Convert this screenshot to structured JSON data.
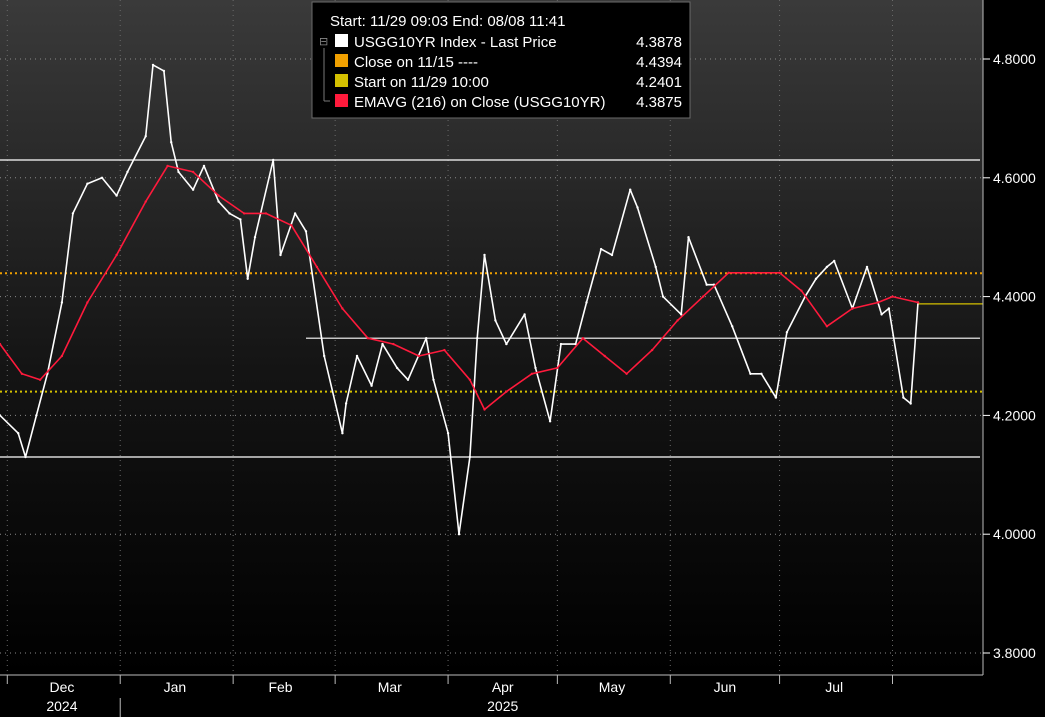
{
  "chart_data": {
    "type": "line",
    "legend": {
      "header": "Start: 11/29 09:03 End: 08/08 11:41",
      "items": [
        {
          "label": "USGG10YR Index - Last Price",
          "value": "4.3878",
          "color": "#ffffff"
        },
        {
          "label": "Close on 11/15 ----",
          "value": "4.4394",
          "color": "#f0a000"
        },
        {
          "label": "Start on 11/29 10:00",
          "value": "4.2401",
          "color": "#d4c000"
        },
        {
          "label": "EMAVG (216)  on Close (USGG10YR)",
          "value": "4.3875",
          "color": "#ff1a3c"
        }
      ]
    },
    "y_axis": {
      "ylim": [
        3.76,
        4.91
      ],
      "ticks": [
        3.8,
        4.0,
        4.2,
        4.4,
        4.6,
        4.8
      ],
      "tick_labels": [
        "3.8000",
        "4.0000",
        "4.2000",
        "4.4000",
        "4.6000",
        "4.8000"
      ],
      "side": "right"
    },
    "x_axis": {
      "month_labels": [
        "Dec",
        "Jan",
        "Feb",
        "Mar",
        "Apr",
        "May",
        "Jun",
        "Jul"
      ],
      "year_labels": [
        "2024",
        "2025"
      ],
      "range": [
        "2024-11-29",
        "2025-08-08"
      ]
    },
    "grid": true,
    "reference_lines": [
      {
        "name": "Close on 11/15",
        "value": 4.4394,
        "style": "dotted",
        "color": "#f0a000"
      },
      {
        "name": "Start on 11/29 10:00",
        "value": 4.2401,
        "style": "dotted",
        "color": "#d4c000"
      },
      {
        "name": "Last Price",
        "value": 4.3878,
        "style": "solid",
        "color": "#d4c000",
        "from": "2025-08-08"
      }
    ],
    "trend_lines": [
      {
        "value": 4.63,
        "from": "2024-11-29",
        "to": "2025-08-08"
      },
      {
        "value": 4.33,
        "from": "2025-02-21",
        "to": "2025-08-08"
      },
      {
        "value": 4.13,
        "from": "2024-11-29",
        "to": "2025-08-08"
      }
    ],
    "series": [
      {
        "name": "USGG10YR Index - Last Price",
        "color": "#ffffff",
        "x": [
          "2024-11-29",
          "2024-12-04",
          "2024-12-06",
          "2024-12-09",
          "2024-12-12",
          "2024-12-16",
          "2024-12-19",
          "2024-12-23",
          "2024-12-27",
          "2024-12-31",
          "2025-01-03",
          "2025-01-08",
          "2025-01-10",
          "2025-01-13",
          "2025-01-15",
          "2025-01-17",
          "2025-01-21",
          "2025-01-24",
          "2025-01-28",
          "2025-01-31",
          "2025-02-03",
          "2025-02-05",
          "2025-02-07",
          "2025-02-12",
          "2025-02-14",
          "2025-02-18",
          "2025-02-21",
          "2025-02-26",
          "2025-03-03",
          "2025-03-04",
          "2025-03-07",
          "2025-03-11",
          "2025-03-14",
          "2025-03-18",
          "2025-03-21",
          "2025-03-26",
          "2025-03-28",
          "2025-04-01",
          "2025-04-04",
          "2025-04-07",
          "2025-04-09",
          "2025-04-11",
          "2025-04-14",
          "2025-04-17",
          "2025-04-22",
          "2025-04-25",
          "2025-04-29",
          "2025-05-02",
          "2025-05-06",
          "2025-05-09",
          "2025-05-13",
          "2025-05-16",
          "2025-05-21",
          "2025-05-23",
          "2025-05-28",
          "2025-05-30",
          "2025-06-04",
          "2025-06-06",
          "2025-06-11",
          "2025-06-13",
          "2025-06-18",
          "2025-06-23",
          "2025-06-26",
          "2025-06-30",
          "2025-07-03",
          "2025-07-08",
          "2025-07-11",
          "2025-07-14",
          "2025-07-16",
          "2025-07-21",
          "2025-07-25",
          "2025-07-29",
          "2025-07-31",
          "2025-08-04",
          "2025-08-06",
          "2025-08-08"
        ],
        "values": [
          4.2,
          4.17,
          4.13,
          4.2,
          4.27,
          4.39,
          4.54,
          4.59,
          4.6,
          4.57,
          4.61,
          4.67,
          4.79,
          4.78,
          4.66,
          4.61,
          4.58,
          4.62,
          4.56,
          4.54,
          4.53,
          4.43,
          4.5,
          4.63,
          4.47,
          4.54,
          4.51,
          4.3,
          4.17,
          4.22,
          4.3,
          4.25,
          4.32,
          4.28,
          4.26,
          4.33,
          4.26,
          4.17,
          4.0,
          4.13,
          4.33,
          4.47,
          4.36,
          4.32,
          4.37,
          4.28,
          4.19,
          4.32,
          4.32,
          4.39,
          4.48,
          4.47,
          4.58,
          4.55,
          4.45,
          4.4,
          4.37,
          4.5,
          4.42,
          4.42,
          4.35,
          4.27,
          4.27,
          4.23,
          4.34,
          4.4,
          4.43,
          4.45,
          4.46,
          4.38,
          4.45,
          4.37,
          4.38,
          4.23,
          4.22,
          4.39
        ]
      },
      {
        "name": "EMAVG (216)  on Close (USGG10YR)",
        "color": "#ff1a3c",
        "x": [
          "2024-11-29",
          "2024-12-05",
          "2024-12-10",
          "2024-12-16",
          "2024-12-23",
          "2024-12-31",
          "2025-01-08",
          "2025-01-14",
          "2025-01-21",
          "2025-01-28",
          "2025-02-04",
          "2025-02-10",
          "2025-02-17",
          "2025-02-24",
          "2025-03-03",
          "2025-03-10",
          "2025-03-17",
          "2025-03-24",
          "2025-03-31",
          "2025-04-07",
          "2025-04-11",
          "2025-04-17",
          "2025-04-24",
          "2025-05-01",
          "2025-05-08",
          "2025-05-14",
          "2025-05-20",
          "2025-05-27",
          "2025-06-03",
          "2025-06-10",
          "2025-06-17",
          "2025-06-24",
          "2025-07-01",
          "2025-07-07",
          "2025-07-14",
          "2025-07-21",
          "2025-07-28",
          "2025-08-01",
          "2025-08-08"
        ],
        "values": [
          4.32,
          4.27,
          4.26,
          4.3,
          4.39,
          4.47,
          4.56,
          4.62,
          4.61,
          4.57,
          4.54,
          4.54,
          4.52,
          4.45,
          4.38,
          4.33,
          4.32,
          4.3,
          4.31,
          4.26,
          4.21,
          4.24,
          4.27,
          4.28,
          4.33,
          4.3,
          4.27,
          4.31,
          4.36,
          4.4,
          4.44,
          4.44,
          4.44,
          4.41,
          4.35,
          4.38,
          4.39,
          4.4,
          4.39
        ]
      }
    ]
  }
}
